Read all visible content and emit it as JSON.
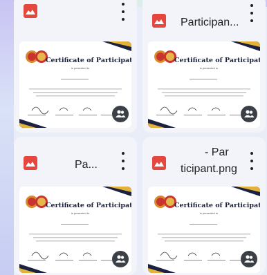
{
  "files": [
    {
      "name": "",
      "icon": "image-file-icon",
      "accent": "#e5463e"
    },
    {
      "name": "Participan...",
      "icon": "image-file-icon",
      "accent": "#e5463e"
    },
    {
      "name": "Pa...",
      "icon": "image-file-icon",
      "accent": "#e5463e"
    },
    {
      "name_line1": "- Par",
      "name_line2": "ticipant.png",
      "icon": "image-file-icon",
      "accent": "#e5463e"
    }
  ],
  "certificate": {
    "title": "Certificate of Participation",
    "subtitle": "is presented to"
  },
  "colors": {
    "background": "#e9edf7",
    "card": "#f2f4fa",
    "file_icon": "#e5463e",
    "cert_navy": "#1b2140",
    "cert_gold": "#e2b23a"
  },
  "icons": {
    "more": "more-vert-icon",
    "shared": "people-icon"
  }
}
